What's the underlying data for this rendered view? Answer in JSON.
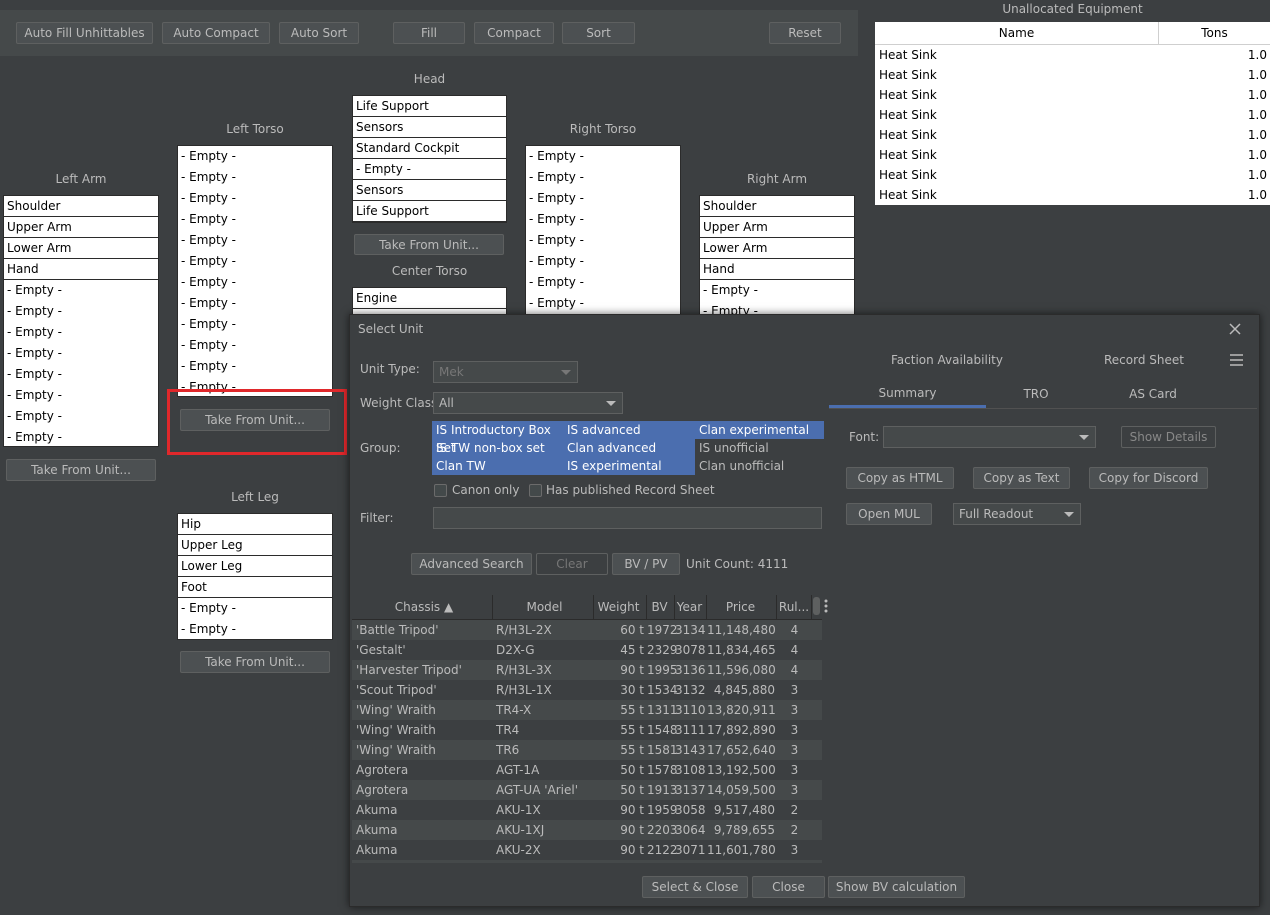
{
  "toolbar": {
    "auto_fill_unhittables": "Auto Fill Unhittables",
    "auto_compact": "Auto Compact",
    "auto_sort": "Auto Sort",
    "fill": "Fill",
    "compact": "Compact",
    "sort": "Sort",
    "reset": "Reset"
  },
  "locations": {
    "head": {
      "title": "Head",
      "slots": [
        "Life Support",
        "Sensors",
        "Standard Cockpit",
        "- Empty -",
        "Sensors",
        "Life Support"
      ]
    },
    "left_torso": {
      "title": "Left Torso",
      "slots": [
        "- Empty -",
        "- Empty -",
        "- Empty -",
        "- Empty -",
        "- Empty -",
        "- Empty -",
        "- Empty -",
        "- Empty -",
        "- Empty -",
        "- Empty -",
        "- Empty -",
        "- Empty -"
      ]
    },
    "right_torso": {
      "title": "Right Torso",
      "slots": [
        "- Empty -",
        "- Empty -",
        "- Empty -",
        "- Empty -",
        "- Empty -",
        "- Empty -",
        "- Empty -",
        "- Empty -"
      ]
    },
    "left_arm": {
      "title": "Left Arm",
      "slots": [
        "Shoulder",
        "Upper Arm",
        "Lower Arm",
        "Hand",
        "- Empty -",
        "- Empty -",
        "- Empty -",
        "- Empty -",
        "- Empty -",
        "- Empty -",
        "- Empty -",
        "- Empty -"
      ]
    },
    "right_arm": {
      "title": "Right Arm",
      "slots": [
        "Shoulder",
        "Upper Arm",
        "Lower Arm",
        "Hand",
        "- Empty -",
        "- Empty -"
      ]
    },
    "center_torso": {
      "title": "Center Torso",
      "slots": [
        "Engine"
      ]
    },
    "left_leg": {
      "title": "Left Leg",
      "slots": [
        "Hip",
        "Upper Leg",
        "Lower Leg",
        "Foot",
        "- Empty -",
        "- Empty -"
      ]
    },
    "take_from_unit": "Take From Unit..."
  },
  "unallocated": {
    "title": "Unallocated Equipment",
    "col_name": "Name",
    "col_tons": "Tons",
    "items": [
      {
        "name": "Heat Sink",
        "tons": "1.0"
      },
      {
        "name": "Heat Sink",
        "tons": "1.0"
      },
      {
        "name": "Heat Sink",
        "tons": "1.0"
      },
      {
        "name": "Heat Sink",
        "tons": "1.0"
      },
      {
        "name": "Heat Sink",
        "tons": "1.0"
      },
      {
        "name": "Heat Sink",
        "tons": "1.0"
      },
      {
        "name": "Heat Sink",
        "tons": "1.0"
      },
      {
        "name": "Heat Sink",
        "tons": "1.0"
      }
    ]
  },
  "dialog": {
    "title": "Select Unit",
    "close_icon": "close-icon",
    "unit_type_label": "Unit Type:",
    "unit_type_value": "Mek",
    "weight_class_label": "Weight Class:",
    "weight_class_value": "All",
    "group_label": "Group:",
    "groups": [
      [
        "IS Introductory Box Set",
        "IS advanced",
        "Clan experimental"
      ],
      [
        "IS TW non-box set",
        "Clan advanced",
        "IS unofficial"
      ],
      [
        "Clan TW",
        "IS experimental",
        "Clan unofficial"
      ]
    ],
    "canon_only": "Canon only",
    "has_record_sheet": "Has published Record Sheet",
    "filter_label": "Filter:",
    "filter_value": "",
    "advanced_search": "Advanced Search",
    "clear": "Clear",
    "bv_pv": "BV / PV",
    "unit_count": "Unit Count: 4111",
    "columns": {
      "chassis": "Chassis ▲",
      "model": "Model",
      "weight": "Weight",
      "bv": "BV",
      "year": "Year",
      "price": "Price",
      "rules": "Rul..."
    },
    "rows": [
      {
        "chassis": "'Battle Tripod'",
        "model": "R/H3L-2X",
        "weight": "60 t",
        "bv": "1972",
        "year": "3134",
        "price": "11,148,480",
        "rules": "4"
      },
      {
        "chassis": "'Gestalt'",
        "model": "D2X-G",
        "weight": "45 t",
        "bv": "2329",
        "year": "3078",
        "price": "11,834,465",
        "rules": "4"
      },
      {
        "chassis": "'Harvester Tripod'",
        "model": "R/H3L-3X",
        "weight": "90 t",
        "bv": "1995",
        "year": "3136",
        "price": "11,596,080",
        "rules": "4"
      },
      {
        "chassis": "'Scout Tripod'",
        "model": "R/H3L-1X",
        "weight": "30 t",
        "bv": "1534",
        "year": "3132",
        "price": "4,845,880",
        "rules": "3"
      },
      {
        "chassis": "'Wing' Wraith",
        "model": "TR4-X",
        "weight": "55 t",
        "bv": "1311",
        "year": "3110",
        "price": "13,820,911",
        "rules": "3"
      },
      {
        "chassis": "'Wing' Wraith",
        "model": "TR4",
        "weight": "55 t",
        "bv": "1548",
        "year": "3111",
        "price": "17,892,890",
        "rules": "3"
      },
      {
        "chassis": "'Wing' Wraith",
        "model": "TR6",
        "weight": "55 t",
        "bv": "1581",
        "year": "3143",
        "price": "17,652,640",
        "rules": "3"
      },
      {
        "chassis": "Agrotera",
        "model": "AGT-1A",
        "weight": "50 t",
        "bv": "1578",
        "year": "3108",
        "price": "13,192,500",
        "rules": "3"
      },
      {
        "chassis": "Agrotera",
        "model": "AGT-UA 'Ariel'",
        "weight": "50 t",
        "bv": "1913",
        "year": "3137",
        "price": "14,059,500",
        "rules": "3"
      },
      {
        "chassis": "Akuma",
        "model": "AKU-1X",
        "weight": "90 t",
        "bv": "1959",
        "year": "3058",
        "price": "9,517,480",
        "rules": "2"
      },
      {
        "chassis": "Akuma",
        "model": "AKU-1XJ",
        "weight": "90 t",
        "bv": "2203",
        "year": "3064",
        "price": "9,789,655",
        "rules": "2"
      },
      {
        "chassis": "Akuma",
        "model": "AKU-2X",
        "weight": "90 t",
        "bv": "2122",
        "year": "3071",
        "price": "11,601,780",
        "rules": "3"
      }
    ],
    "select_close": "Select & Close",
    "close": "Close",
    "show_bv": "Show BV calculation",
    "right": {
      "faction_availability": "Faction Availability",
      "record_sheet": "Record Sheet",
      "tabs": [
        "Summary",
        "TRO",
        "AS Card"
      ],
      "font_label": "Font:",
      "font_value": "",
      "show_details": "Show Details",
      "copy_html": "Copy as HTML",
      "copy_text": "Copy as Text",
      "copy_discord": "Copy for Discord",
      "open_mul": "Open MUL",
      "readout_value": "Full Readout"
    }
  },
  "colors": {
    "background": "#3c3f41",
    "selection": "#4b6eaf",
    "highlight": "#e0282b"
  }
}
